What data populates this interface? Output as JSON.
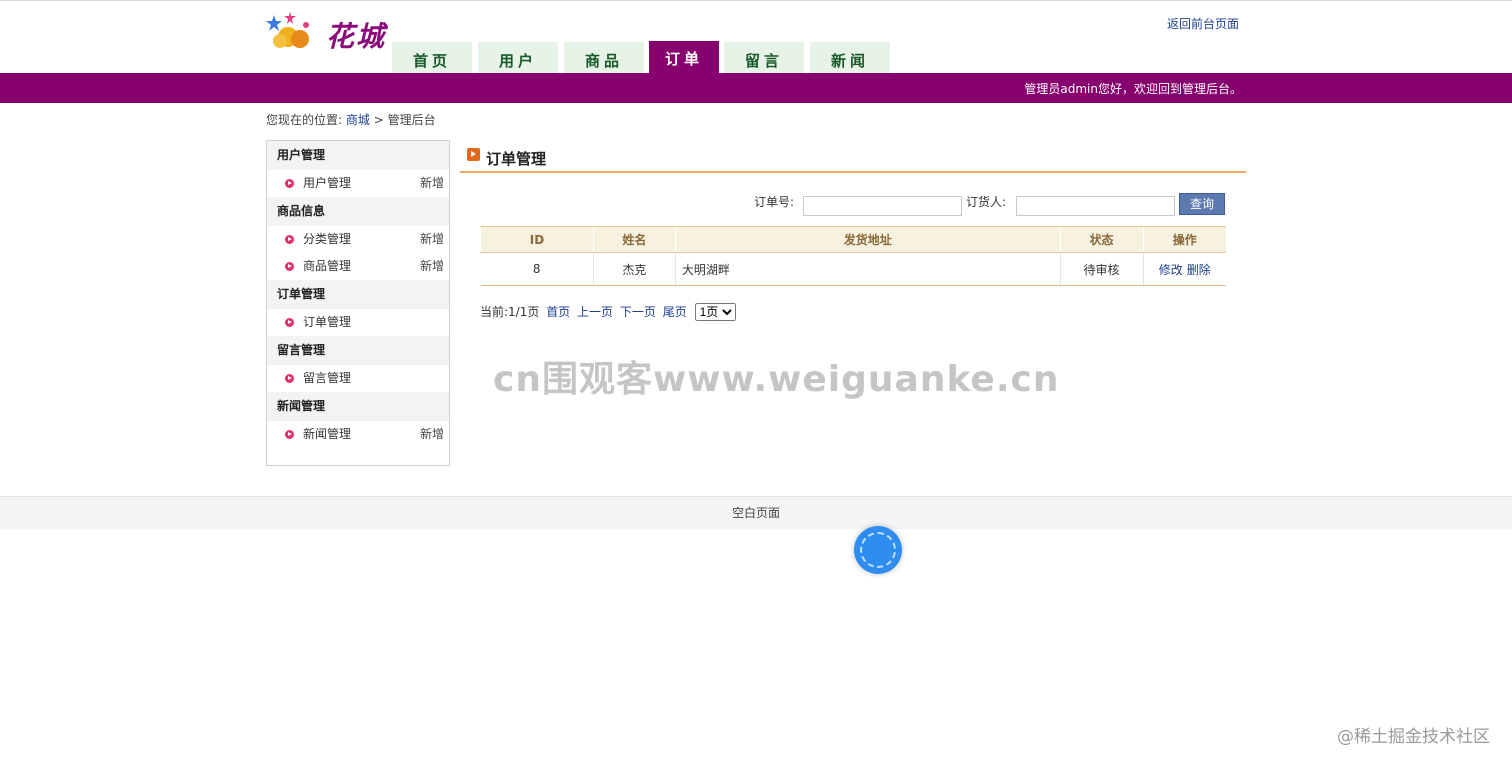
{
  "header": {
    "logo_text": "花城",
    "back_link": "返回前台页面",
    "nav_tabs": [
      {
        "label": "首页"
      },
      {
        "label": "用户"
      },
      {
        "label": "商品"
      },
      {
        "label": "订单"
      },
      {
        "label": "留言"
      },
      {
        "label": "新闻"
      }
    ],
    "active_tab": "订单",
    "welcome": "管理员admin您好，欢迎回到管理后台。"
  },
  "breadcrumb": {
    "prefix": "您现在的位置:",
    "link": "商城",
    "separator": ">",
    "current": "管理后台"
  },
  "sidebar": {
    "groups": [
      {
        "title": "用户管理",
        "items": [
          {
            "label": "用户管理",
            "add": "新增"
          }
        ]
      },
      {
        "title": "商品信息",
        "items": [
          {
            "label": "分类管理",
            "add": "新增"
          },
          {
            "label": "商品管理",
            "add": "新增"
          }
        ]
      },
      {
        "title": "订单管理",
        "items": [
          {
            "label": "订单管理",
            "add": ""
          }
        ]
      },
      {
        "title": "留言管理",
        "items": [
          {
            "label": "留言管理",
            "add": ""
          }
        ]
      },
      {
        "title": "新闻管理",
        "items": [
          {
            "label": "新闻管理",
            "add": "新增"
          }
        ]
      }
    ]
  },
  "main": {
    "title": "订单管理",
    "search": {
      "order_no_label": "订单号:",
      "order_no_value": "",
      "buyer_label": "订货人:",
      "buyer_value": "",
      "query_button": "查询"
    },
    "table": {
      "headers": [
        "ID",
        "姓名",
        "发货地址",
        "状态",
        "操作"
      ],
      "rows": [
        {
          "id": "8",
          "name": "杰克",
          "address": "大明湖畔",
          "status": "待审核",
          "edit": "修改",
          "delete": "删除"
        }
      ]
    },
    "pager": {
      "current": "当前:1/1页",
      "first": "首页",
      "prev": "上一页",
      "next": "下一页",
      "last": "尾页",
      "select_value": "1页"
    }
  },
  "watermark": "cn围观客www.weiguanke.cn",
  "footer": {
    "text": "空白页面"
  },
  "bottom_mark": "@稀土掘金技术社区",
  "colors": {
    "brand": "#86006e",
    "accent": "#e8a862",
    "link": "#1d3f8f",
    "button": "#5d7ab0"
  }
}
